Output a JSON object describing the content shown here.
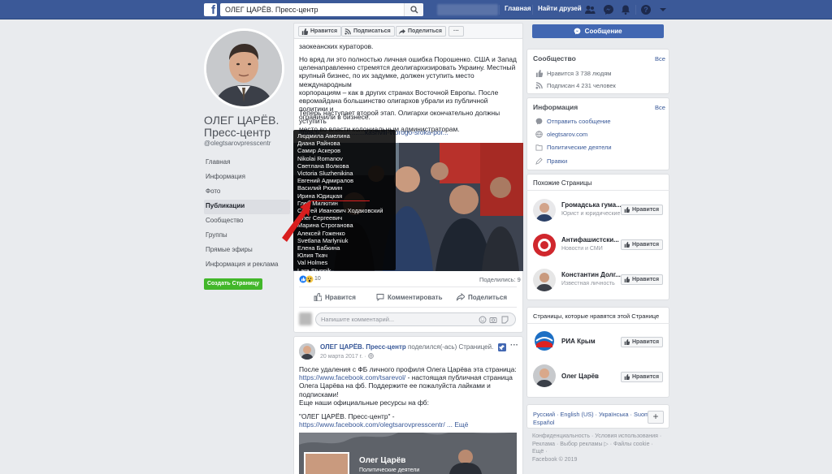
{
  "topbar": {
    "search_value": "ОЛЕГ ЦАРЁВ. Пресс-центр",
    "home": "Главная",
    "find_friends": "Найти друзей"
  },
  "page": {
    "name": "ОЛЕГ ЦАРЁВ. Пресс-центр",
    "handle": "@olegtsarovpresscentr",
    "create_page": "Создать Страницу"
  },
  "left_nav": [
    "Главная",
    "Информация",
    "Фото",
    "Публикации",
    "Сообщество",
    "Группы",
    "Прямые эфиры",
    "Информация и реклама"
  ],
  "actions": {
    "like": "Нравится",
    "follow": "Подписаться",
    "share": "Поделиться",
    "more": "···"
  },
  "post1": {
    "lines_a": [
      "заокеанских кураторов."
    ],
    "lines_b": [
      "Но вряд ли это полностью личная ошибка Порошенко. США и Запад",
      "целенаправленно стремятся деолигархизировать Украину. Местный",
      "крупный бизнес, по их задумке, должен уступить место международным",
      "корпорациям – как в других странах Восточной Европы. После",
      "евромайдана большинство олигархов убрали из публичной политики и",
      "ограничили в бизнесе."
    ],
    "lines_c": [
      "Теперь наступает второй этап. Олигархи окончательно должны уступить",
      "место во власти колониальным администраторам."
    ],
    "link": "https://........................kashvili-vtorogo-sroka-por...",
    "tooltip_names": [
      "Людмила Амелина",
      "Диана Райнова",
      "Самир Аскеров",
      "Nikolai Romanov",
      "Светлана Волкова",
      "Victoria Sluzhenikina",
      "Евгений Адмиралов",
      "Василий Рюмин",
      "Ирина Юдицкая",
      "Глеб Милютин",
      "Сергей Иванович Ходаковский",
      "Олег Сергеевич",
      "Марина Строганова",
      "Алексей Гоженко",
      "Svetlana Marlyniuk",
      "Елена Бабкина",
      "Юлия Ткач",
      "Val Holmes",
      "Lara Stupnik"
    ],
    "reaction_count": "10",
    "shares": "Поделились: 9",
    "like": "Нравится",
    "comment": "Комментировать",
    "share": "Поделиться",
    "comment_placeholder": "Напишите комментарий..."
  },
  "post2": {
    "author": "ОЛЕГ ЦАРЁВ. Пресс-центр",
    "shared_text": " поделился(-ась) Страницей.",
    "date": "20 марта 2017 г. ·",
    "lines_a": [
      "После удаления с ФБ личного профиля Олега Царёва эта страница:"
    ],
    "link1": "https://www.facebook.com/tsarevol/",
    "after_link1": " - настоящая публичная страница",
    "lines_b": [
      "Олега Царёва на фб. Поддержите ее пожалуйста лайками и",
      "подписками!",
      "Еще наши официальные ресурсы на фб:"
    ],
    "quote": "\"ОЛЕГ ЦАРЁВ. Пресс-центр\" -",
    "link2": "https://www.facebook.com/olegtsarovpresscentr/",
    "more": "... Ещё",
    "cover_name": "Олег Царёв",
    "cover_sub": "Политические деятели"
  },
  "right": {
    "message_button": "Сообщение",
    "community": {
      "title": "Сообщество",
      "all": "Все",
      "likes": "Нравится 3 738 людям",
      "followers": "Подписан 4 231 человек"
    },
    "info": {
      "title": "Информация",
      "all": "Все",
      "send_message": "Отправить сообщение",
      "site": "olegtsarov.com",
      "category": "Политические деятели",
      "rules": "Правки"
    },
    "similar": {
      "title": "Похожие Страницы",
      "items": [
        {
          "name": "Громадська гума...",
          "cat": "Юрист и юридические ...",
          "btn": "Нравится"
        },
        {
          "name": "Антифашистски...",
          "cat": "Новости и СМИ",
          "btn": "Нравится"
        },
        {
          "name": "Константин Долг...",
          "cat": "Известная личность",
          "btn": "Нравится"
        }
      ]
    },
    "liked": {
      "title": "Страницы, которые нравятся этой Странице",
      "items": [
        {
          "name": "РИА Крым",
          "btn": "Нравится"
        },
        {
          "name": "Олег Царёв",
          "btn": "Нравится"
        }
      ]
    },
    "languages": {
      "line1": "Русский · English (US) · Українська · Suomi",
      "line2": "Español"
    },
    "footer": {
      "line1": "Конфиденциальность · Условия использования ·",
      "line2": "Реклама · Выбор рекламы ▷ · Файлы cookie ·",
      "line3": "Ещё ·",
      "line4": "Facebook © 2019"
    }
  }
}
